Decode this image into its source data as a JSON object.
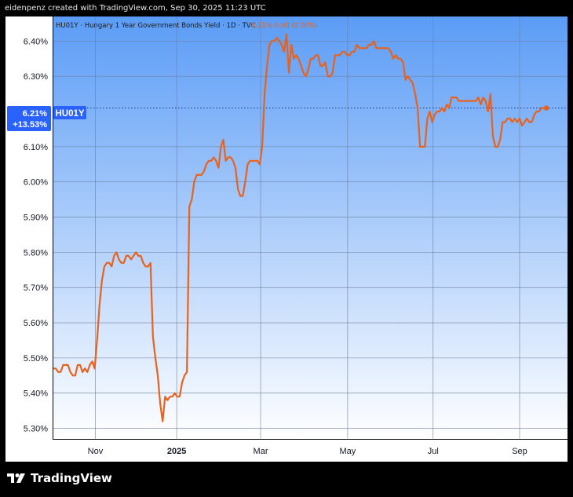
{
  "header": {
    "caption": "eidenpenz created with TradingView.com, Sep 30, 2025 11:23 UTC"
  },
  "legend": {
    "symbol_text": "HU01Y · Hungary 1 Year Government Bonds Yield · 1D · TVC",
    "value_text": "6.21%  0.00 (0.00%)"
  },
  "price_badge": {
    "value": "6.21%",
    "change": "+13.53%",
    "symbol": "HU01Y"
  },
  "footer": {
    "brand": "TradingView"
  },
  "colors": {
    "line": "#e8621c",
    "badge": "#2962ff",
    "grad_top": "#5b9cf6",
    "grad_bottom": "#ffffff",
    "price_line": "#1c3fa8"
  },
  "chart_data": {
    "type": "line",
    "series": [
      {
        "values": [
          5.47,
          5.47,
          5.46,
          5.46,
          5.48,
          5.48,
          5.48,
          5.46,
          5.45,
          5.45,
          5.48,
          5.48,
          5.46,
          5.47,
          5.46,
          5.48,
          5.49,
          5.47,
          5.55,
          5.65,
          5.72,
          5.76,
          5.77,
          5.77,
          5.76,
          5.79,
          5.8,
          5.78,
          5.77,
          5.77,
          5.79,
          5.79,
          5.78,
          5.79,
          5.8,
          5.79,
          5.79,
          5.77,
          5.76,
          5.76,
          5.77,
          5.56,
          5.5,
          5.45,
          5.37,
          5.32,
          5.39,
          5.38,
          5.39,
          5.39,
          5.4,
          5.39,
          5.39,
          5.43,
          5.45,
          5.46,
          5.93,
          5.95,
          6.0,
          6.02,
          6.02,
          6.02,
          6.03,
          6.05,
          6.06,
          6.06,
          6.07,
          6.06,
          6.04,
          6.1,
          6.12,
          6.06,
          6.07,
          6.07,
          6.06,
          6.04,
          5.98,
          5.96,
          5.96,
          6.0,
          6.05,
          6.06,
          6.06,
          6.06,
          6.06,
          6.05,
          6.1,
          6.25,
          6.33,
          6.39,
          6.4,
          6.4,
          6.41,
          6.4,
          6.39,
          6.37,
          6.42,
          6.31,
          6.39,
          6.35,
          6.36,
          6.35,
          6.33,
          6.31,
          6.3,
          6.32,
          6.35,
          6.35,
          6.36,
          6.36,
          6.33,
          6.33,
          6.34,
          6.3,
          6.3,
          6.31,
          6.36,
          6.36,
          6.36,
          6.37,
          6.37,
          6.36,
          6.36,
          6.37,
          6.37,
          6.39,
          6.38,
          6.38,
          6.38,
          6.38,
          6.39,
          6.39,
          6.4,
          6.38,
          6.38,
          6.38,
          6.38,
          6.38,
          6.38,
          6.37,
          6.35,
          6.36,
          6.35,
          6.35,
          6.34,
          6.29,
          6.3,
          6.29,
          6.28,
          6.25,
          6.21,
          6.1,
          6.1,
          6.1,
          6.18,
          6.2,
          6.17,
          6.19,
          6.2,
          6.2,
          6.21,
          6.2,
          6.22,
          6.21,
          6.24,
          6.24,
          6.24,
          6.23,
          6.23,
          6.23,
          6.23,
          6.23,
          6.23,
          6.23,
          6.23,
          6.24,
          6.22,
          6.24,
          6.23,
          6.2,
          6.25,
          6.13,
          6.1,
          6.1,
          6.12,
          6.17,
          6.17,
          6.18,
          6.18,
          6.17,
          6.18,
          6.17,
          6.18,
          6.16,
          6.17,
          6.18,
          6.17,
          6.17,
          6.19,
          6.2,
          6.2,
          6.21,
          6.21,
          6.21
        ]
      }
    ],
    "x_ticks": [
      "Nov",
      "2025",
      "Mar",
      "May",
      "Jul",
      "Sep"
    ],
    "y_ticks": [
      "6.40%",
      "6.30%",
      "6.21%",
      "6.10%",
      "6.00%",
      "5.90%",
      "5.80%",
      "5.70%",
      "5.60%",
      "5.50%",
      "5.40%",
      "5.30%"
    ],
    "ylim": [
      5.27,
      6.47
    ],
    "last_value": 6.21,
    "grid": true
  }
}
